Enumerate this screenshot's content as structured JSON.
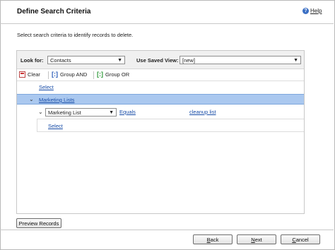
{
  "dialog": {
    "title": "Define Search Criteria",
    "help_label": "Help",
    "instructions": "Select search criteria to identify records to delete."
  },
  "criteria": {
    "look_for_label": "Look for:",
    "look_for_value": "Contacts",
    "saved_view_label": "Use Saved View:",
    "saved_view_value": "[new]"
  },
  "toolbar": {
    "clear_label": "Clear",
    "group_and_label": "Group AND",
    "group_or_label": "Group OR"
  },
  "tree": {
    "select_top": "Select",
    "related_entity": "Marketing Lists",
    "condition_field": "Marketing List",
    "condition_operator": "Equals",
    "condition_value": "cleanup list",
    "select_nested": "Select"
  },
  "buttons": {
    "preview": "Preview Records",
    "back_key": "B",
    "back_rest": "ack",
    "next_key": "N",
    "next_rest": "ext",
    "cancel_key": "C",
    "cancel_rest": "ancel"
  }
}
